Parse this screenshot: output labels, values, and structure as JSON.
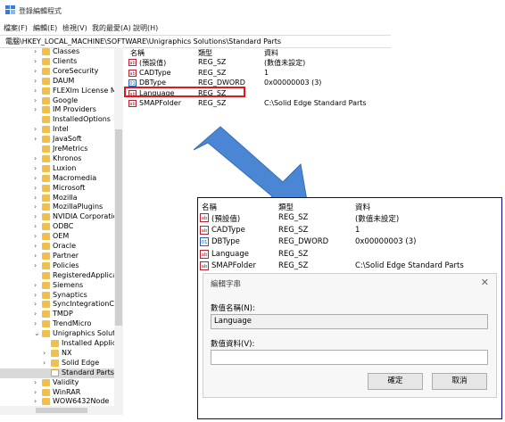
{
  "window": {
    "title": "登錄編輯程式"
  },
  "menu": [
    "檔案(F)",
    "編輯(E)",
    "檢視(V)",
    "我的最愛(A)",
    "說明(H)"
  ],
  "address": "電腦\\HKEY_LOCAL_MACHINE\\SOFTWARE\\Unigraphics Solutions\\Standard Parts",
  "tree": [
    {
      "label": "Classes",
      "indent": 0,
      "chev": "›"
    },
    {
      "label": "Clients",
      "indent": 0,
      "chev": "›"
    },
    {
      "label": "CoreSecurity",
      "indent": 0,
      "chev": "›"
    },
    {
      "label": "DAUM",
      "indent": 0,
      "chev": "›"
    },
    {
      "label": "FLEXlm License Mar",
      "indent": 0,
      "chev": "›"
    },
    {
      "label": "Google",
      "indent": 0,
      "chev": "›"
    },
    {
      "label": "IM Providers",
      "indent": 0,
      "chev": "›"
    },
    {
      "label": "InstalledOptions",
      "indent": 0,
      "chev": ""
    },
    {
      "label": "Intel",
      "indent": 0,
      "chev": "›"
    },
    {
      "label": "JavaSoft",
      "indent": 0,
      "chev": "›"
    },
    {
      "label": "JreMetrics",
      "indent": 0,
      "chev": ""
    },
    {
      "label": "Khronos",
      "indent": 0,
      "chev": "›"
    },
    {
      "label": "Luxion",
      "indent": 0,
      "chev": "›"
    },
    {
      "label": "Macromedia",
      "indent": 0,
      "chev": "›"
    },
    {
      "label": "Microsoft",
      "indent": 0,
      "chev": "›"
    },
    {
      "label": "Mozilla",
      "indent": 0,
      "chev": "›"
    },
    {
      "label": "MozillaPlugins",
      "indent": 0,
      "chev": "›"
    },
    {
      "label": "NVIDIA Corporation",
      "indent": 0,
      "chev": "›"
    },
    {
      "label": "ODBC",
      "indent": 0,
      "chev": "›"
    },
    {
      "label": "OEM",
      "indent": 0,
      "chev": "›"
    },
    {
      "label": "Oracle",
      "indent": 0,
      "chev": "›"
    },
    {
      "label": "Partner",
      "indent": 0,
      "chev": "›"
    },
    {
      "label": "Policies",
      "indent": 0,
      "chev": "›"
    },
    {
      "label": "RegisteredApplicati",
      "indent": 0,
      "chev": ""
    },
    {
      "label": "Siemens",
      "indent": 0,
      "chev": "›"
    },
    {
      "label": "Synaptics",
      "indent": 0,
      "chev": "›"
    },
    {
      "label": "SyncIntegrationClie",
      "indent": 0,
      "chev": "›"
    },
    {
      "label": "TMDP",
      "indent": 0,
      "chev": "›"
    },
    {
      "label": "TrendMicro",
      "indent": 0,
      "chev": "›"
    },
    {
      "label": "Unigraphics Solutio",
      "indent": 0,
      "chev": "⌄"
    },
    {
      "label": "Installed Applicat",
      "indent": 1,
      "chev": ""
    },
    {
      "label": "NX",
      "indent": 1,
      "chev": "›"
    },
    {
      "label": "Solid Edge",
      "indent": 1,
      "chev": "›"
    },
    {
      "label": "Standard Parts",
      "indent": 1,
      "chev": "",
      "selected": true
    },
    {
      "label": "Validity",
      "indent": 0,
      "chev": "›"
    },
    {
      "label": "WinRAR",
      "indent": 0,
      "chev": "›"
    },
    {
      "label": "WOW6432Node",
      "indent": 0,
      "chev": "›"
    }
  ],
  "list": {
    "headers": [
      "名稱",
      "類型",
      "資料"
    ],
    "rows": [
      {
        "name": "(預設值)",
        "type": "REG_SZ",
        "data": "(數值未設定)",
        "icon": "string-value-icon"
      },
      {
        "name": "CADType",
        "type": "REG_SZ",
        "data": "1",
        "icon": "string-value-icon"
      },
      {
        "name": "DBType",
        "type": "REG_DWORD",
        "data": "0x00000003 (3)",
        "icon": "binary-value-icon"
      },
      {
        "name": "Language",
        "type": "REG_SZ",
        "data": "",
        "icon": "string-value-icon"
      },
      {
        "name": "SMAPFolder",
        "type": "REG_SZ",
        "data": "C:\\Solid Edge Standard Parts",
        "icon": "string-value-icon"
      }
    ]
  },
  "dialog": {
    "title": "編輯字串",
    "name_label": "數值名稱(N):",
    "name_value": "Language",
    "data_label": "數值資料(V):",
    "data_value": "",
    "ok": "確定",
    "cancel": "取消"
  },
  "colors": {
    "highlight": "#e0191f",
    "arrow": "#4a86d4",
    "inset_border": "#000a88",
    "folder": "#f2c04a"
  }
}
